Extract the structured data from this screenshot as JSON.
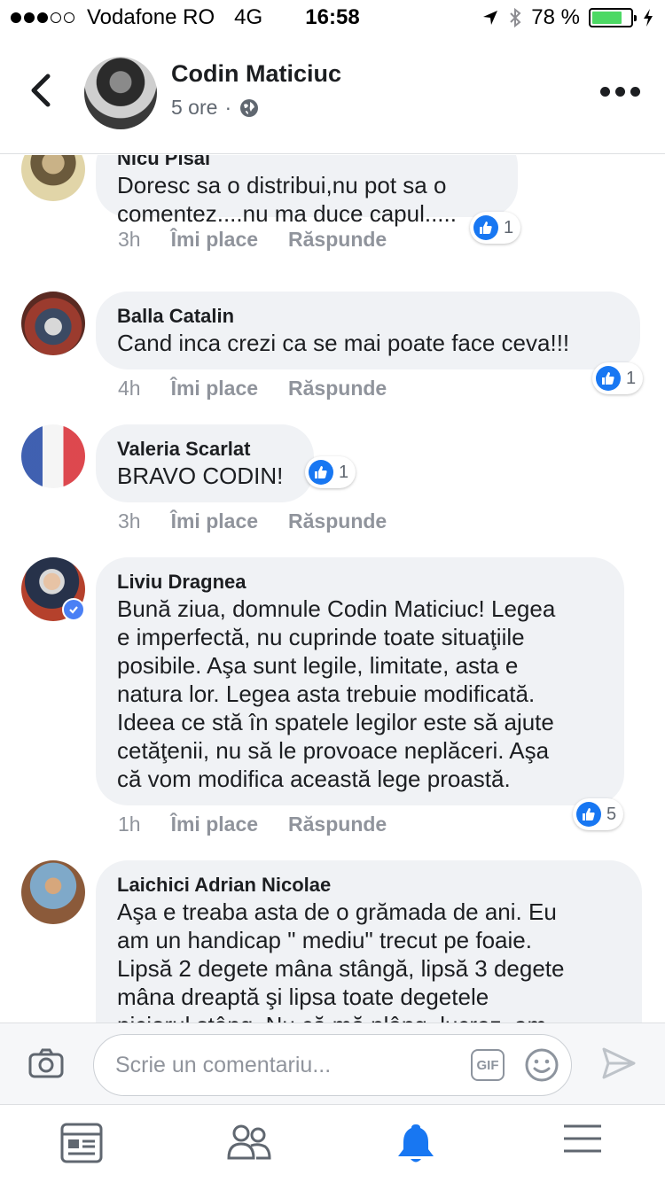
{
  "status_bar": {
    "carrier": "Vodafone RO",
    "network": "4G",
    "time": "16:58",
    "battery": "78 %",
    "battery_level": 0.78
  },
  "header": {
    "name": "Codin Maticiuc",
    "subtitle": "5 ore",
    "separator": "·"
  },
  "action_labels": {
    "like": "Îmi place",
    "reply": "Răspunde"
  },
  "comments": [
    {
      "author": "Nicu Pisai",
      "text": [
        "Doresc sa o distribui,nu pot sa o",
        "comentez....nu ma duce capul....."
      ],
      "time": "3h",
      "reactions": "1"
    },
    {
      "author": "Balla Catalin",
      "text": [
        "Cand inca crezi ca se mai poate face ceva!!!"
      ],
      "time": "4h",
      "reactions": "1"
    },
    {
      "author": "Valeria Scarlat",
      "text": [
        "BRAVO CODIN!"
      ],
      "time": "3h",
      "reactions": "1"
    },
    {
      "author": "Liviu Dragnea",
      "verified": true,
      "text": [
        "Bună ziua, domnule Codin Maticiuc! Legea",
        "e imperfectă, nu cuprinde toate situaţiile",
        "posibile. Aşa sunt legile, limitate, asta e",
        "natura lor. Legea asta trebuie modificată.",
        "Ideea ce stă în spatele legilor este să ajute",
        "cetăţenii, nu să le provoace neplăceri. Aşa",
        "că vom modifica această lege proastă."
      ],
      "time": "1h",
      "reactions": "5"
    },
    {
      "author": "Laichici Adrian Nicolae",
      "text": [
        "Aşa e treaba asta de o grămada de ani. Eu",
        "am un handicap \" mediu\" trecut pe foaie.",
        "Lipsă 2 degete mâna stângă, lipsă 3 degete",
        "mâna dreaptă şi lipsa toate degetele",
        "piciorul stâng. Nu că mă plâng, lucrez, am"
      ]
    }
  ],
  "composer": {
    "placeholder": "Scrie un comentariu...",
    "gif_label": "GIF"
  },
  "colors": {
    "accent": "#1877f2",
    "bubble": "#f0f2f5",
    "muted": "#90949c"
  },
  "icons": [
    "back-icon",
    "globe-icon",
    "more-icon",
    "camera-icon",
    "gif-icon",
    "emoji-icon",
    "send-icon",
    "news-feed-icon",
    "friends-icon",
    "notifications-icon",
    "menu-icon"
  ]
}
